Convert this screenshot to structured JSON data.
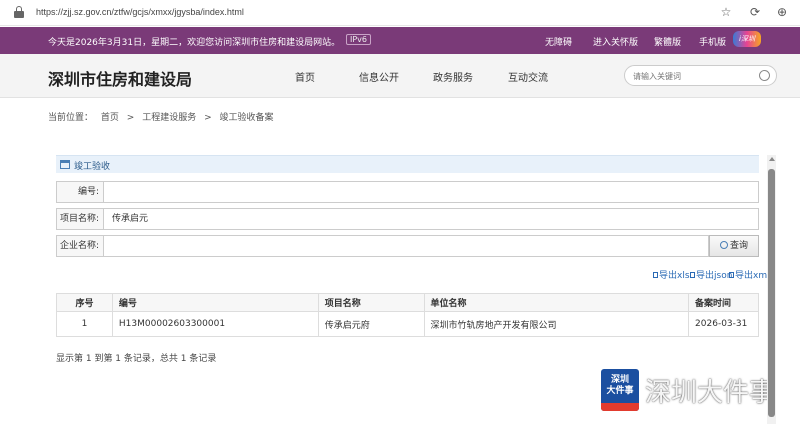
{
  "browser": {
    "url": "https://zjj.sz.gov.cn/ztfw/gcjs/xmxx/jgysba/index.html",
    "icons": [
      "star-icon",
      "refresh-icon",
      "extension-icon"
    ]
  },
  "topbar": {
    "welcome": "今天是2026年3月31日，星期二，欢迎您访问深圳市住房和建设局网站。",
    "ipv6": "IPv6",
    "links": [
      "无障碍",
      "进入关怀版",
      "繁體版",
      "手机版"
    ],
    "badge": "i深圳"
  },
  "header": {
    "title": "深圳市住房和建设局",
    "nav": [
      "首页",
      "信息公开",
      "政务服务",
      "互动交流"
    ],
    "search_placeholder": "请输入关键词"
  },
  "breadcrumb": {
    "label": "当前位置：",
    "items": [
      "首页",
      ">",
      "工程建设服务",
      ">",
      "竣工验收备案"
    ]
  },
  "section": {
    "title": "竣工验收"
  },
  "form": {
    "number_label": "编号:",
    "number_value": "",
    "project_label": "项目名称:",
    "project_value": "传承启元",
    "company_label": "企业名称:",
    "company_value": "",
    "query_label": "查询"
  },
  "exports": [
    "导出xls",
    "导出json",
    "导出xml"
  ],
  "table": {
    "headers": [
      "序号",
      "编号",
      "项目名称",
      "单位名称",
      "备案时间"
    ],
    "rows": [
      [
        "1",
        "H13M00002603300001",
        "传承启元府",
        "深圳市竹轨房地产开发有限公司",
        "2026-03-31"
      ]
    ]
  },
  "pager": "显示第 1 到第 1 条记录，总共 1 条记录",
  "watermark": {
    "logo_line1": "深圳",
    "logo_line2": "大件事",
    "text": "深圳大件事"
  }
}
